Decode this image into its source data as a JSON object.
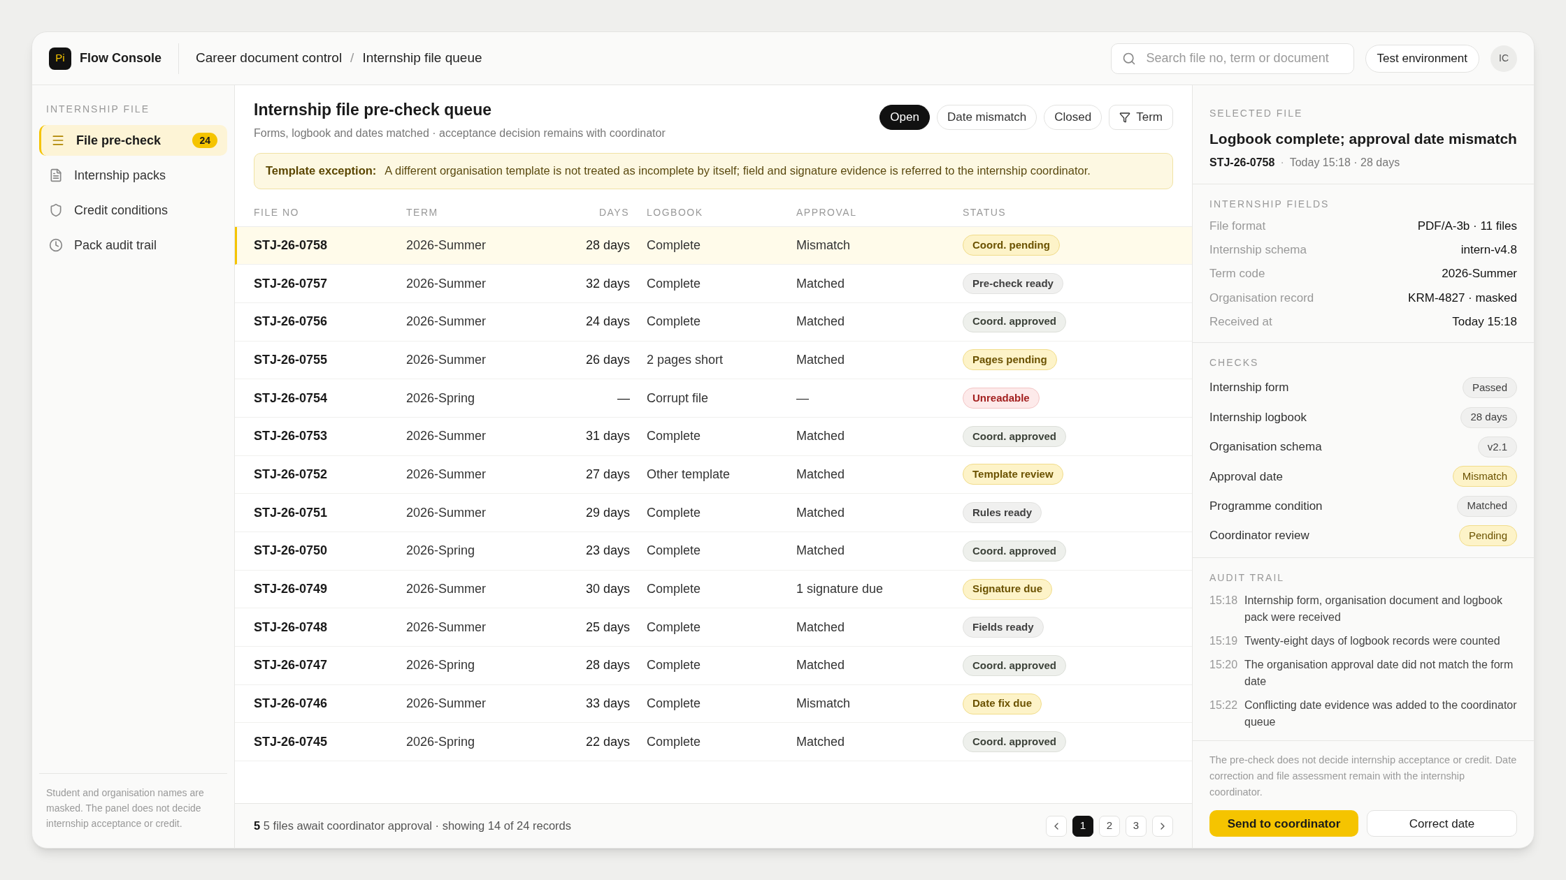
{
  "header": {
    "logo": "Pi",
    "app_name": "Flow Console",
    "breadcrumb": [
      "Career document control",
      "Internship file queue"
    ],
    "breadcrumb_separator": "/",
    "search": {
      "placeholder": "Search file no, term or document"
    },
    "environment": "Test environment",
    "avatar": "IC"
  },
  "sidebar": {
    "heading": "INTERNSHIP FILE",
    "items": [
      {
        "label": "File pre-check",
        "badge": "24",
        "selected": true
      },
      {
        "label": "Internship packs",
        "selected": false
      },
      {
        "label": "Credit conditions",
        "selected": false
      },
      {
        "label": "Pack audit trail",
        "selected": false
      }
    ],
    "note": "Student and organisation names are masked. The panel does not decide internship acceptance or credit."
  },
  "main": {
    "title": "Internship file pre-check queue",
    "subtitle": "Forms, logbook and dates matched · acceptance decision remains with coordinator",
    "filters": [
      {
        "label": "Open",
        "selected": true
      },
      {
        "label": "Date mismatch",
        "selected": false
      },
      {
        "label": "Closed",
        "selected": false
      },
      {
        "label": "Term",
        "selected": false,
        "kind": "filter"
      }
    ],
    "notice": {
      "label": "Template exception:",
      "text": "A different organisation template is not treated as incomplete by itself; field and signature evidence is referred to the internship coordinator."
    },
    "table": {
      "columns": [
        "FILE NO",
        "TERM",
        "DAYS",
        "LOGBOOK",
        "APPROVAL",
        "STATUS"
      ],
      "rows": [
        {
          "file_no": "STJ-26-0758",
          "term": "2026-Summer",
          "days": "28 days",
          "logbook": "Complete",
          "approval": "Mismatch",
          "status": "Coord. pending",
          "kind": "warn",
          "selected": true
        },
        {
          "file_no": "STJ-26-0757",
          "term": "2026-Summer",
          "days": "32 days",
          "logbook": "Complete",
          "approval": "Matched",
          "status": "Pre-check ready",
          "kind": "neutral",
          "selected": false
        },
        {
          "file_no": "STJ-26-0756",
          "term": "2026-Summer",
          "days": "24 days",
          "logbook": "Complete",
          "approval": "Matched",
          "status": "Coord. approved",
          "kind": "ok",
          "selected": false
        },
        {
          "file_no": "STJ-26-0755",
          "term": "2026-Summer",
          "days": "26 days",
          "logbook": "2 pages short",
          "approval": "Matched",
          "status": "Pages pending",
          "kind": "warn",
          "selected": false
        },
        {
          "file_no": "STJ-26-0754",
          "term": "2026-Spring",
          "days": "—",
          "logbook": "Corrupt file",
          "approval": "—",
          "status": "Unreadable",
          "kind": "error",
          "selected": false
        },
        {
          "file_no": "STJ-26-0753",
          "term": "2026-Summer",
          "days": "31 days",
          "logbook": "Complete",
          "approval": "Matched",
          "status": "Coord. approved",
          "kind": "ok",
          "selected": false
        },
        {
          "file_no": "STJ-26-0752",
          "term": "2026-Summer",
          "days": "27 days",
          "logbook": "Other template",
          "approval": "Matched",
          "status": "Template review",
          "kind": "warn",
          "selected": false
        },
        {
          "file_no": "STJ-26-0751",
          "term": "2026-Summer",
          "days": "29 days",
          "logbook": "Complete",
          "approval": "Matched",
          "status": "Rules ready",
          "kind": "neutral",
          "selected": false
        },
        {
          "file_no": "STJ-26-0750",
          "term": "2026-Spring",
          "days": "23 days",
          "logbook": "Complete",
          "approval": "Matched",
          "status": "Coord. approved",
          "kind": "ok",
          "selected": false
        },
        {
          "file_no": "STJ-26-0749",
          "term": "2026-Summer",
          "days": "30 days",
          "logbook": "Complete",
          "approval": "1 signature due",
          "status": "Signature due",
          "kind": "warn",
          "selected": false
        },
        {
          "file_no": "STJ-26-0748",
          "term": "2026-Summer",
          "days": "25 days",
          "logbook": "Complete",
          "approval": "Matched",
          "status": "Fields ready",
          "kind": "neutral",
          "selected": false
        },
        {
          "file_no": "STJ-26-0747",
          "term": "2026-Spring",
          "days": "28 days",
          "logbook": "Complete",
          "approval": "Matched",
          "status": "Coord. approved",
          "kind": "ok",
          "selected": false
        },
        {
          "file_no": "STJ-26-0746",
          "term": "2026-Summer",
          "days": "33 days",
          "logbook": "Complete",
          "approval": "Mismatch",
          "status": "Date fix due",
          "kind": "warn",
          "selected": false
        },
        {
          "file_no": "STJ-26-0745",
          "term": "2026-Spring",
          "days": "22 days",
          "logbook": "Complete",
          "approval": "Matched",
          "status": "Coord. approved",
          "kind": "ok",
          "selected": false
        }
      ]
    },
    "footer": {
      "count": "5",
      "text": "5 files await coordinator approval · showing 14 of 24 records",
      "pages": [
        {
          "label": "1",
          "selected": true
        },
        {
          "label": "2",
          "selected": false
        },
        {
          "label": "3",
          "selected": false
        }
      ]
    }
  },
  "details": {
    "heading": "SELECTED FILE",
    "title": "Logbook complete; approval date mismatch",
    "file_no": "STJ-26-0758",
    "meta_separator": "·",
    "meta": "Today 15:18 · 28 days",
    "fields_heading": "INTERNSHIP FIELDS",
    "fields": [
      {
        "label": "File format",
        "value": "PDF/A-3b · 11 files"
      },
      {
        "label": "Internship schema",
        "value": "intern-v4.8"
      },
      {
        "label": "Term code",
        "value": "2026-Summer"
      },
      {
        "label": "Organisation record",
        "value": "KRM-4827 · masked"
      },
      {
        "label": "Received at",
        "value": "Today 15:18"
      }
    ],
    "checks_heading": "CHECKS",
    "checks": [
      {
        "label": "Internship form",
        "value": "Passed",
        "kind": "neutral"
      },
      {
        "label": "Internship logbook",
        "value": "28 days",
        "kind": "neutral"
      },
      {
        "label": "Organisation schema",
        "value": "v2.1",
        "kind": "neutral"
      },
      {
        "label": "Approval date",
        "value": "Mismatch",
        "kind": "warn"
      },
      {
        "label": "Programme condition",
        "value": "Matched",
        "kind": "neutral"
      },
      {
        "label": "Coordinator review",
        "value": "Pending",
        "kind": "warn"
      }
    ],
    "audit_heading": "AUDIT TRAIL",
    "audit": [
      {
        "time": "15:18",
        "text": "Internship form, organisation document and logbook pack were received"
      },
      {
        "time": "15:19",
        "text": "Twenty-eight days of logbook records were counted"
      },
      {
        "time": "15:20",
        "text": "The organisation approval date did not match the form date"
      },
      {
        "time": "15:22",
        "text": "Conflicting date evidence was added to the coordinator queue"
      }
    ],
    "disclaimer": "The pre-check does not decide internship acceptance or credit. Date correction and file assessment remain with the internship coordinator.",
    "primary_action": "Send to coordinator",
    "secondary_action": "Correct date"
  }
}
